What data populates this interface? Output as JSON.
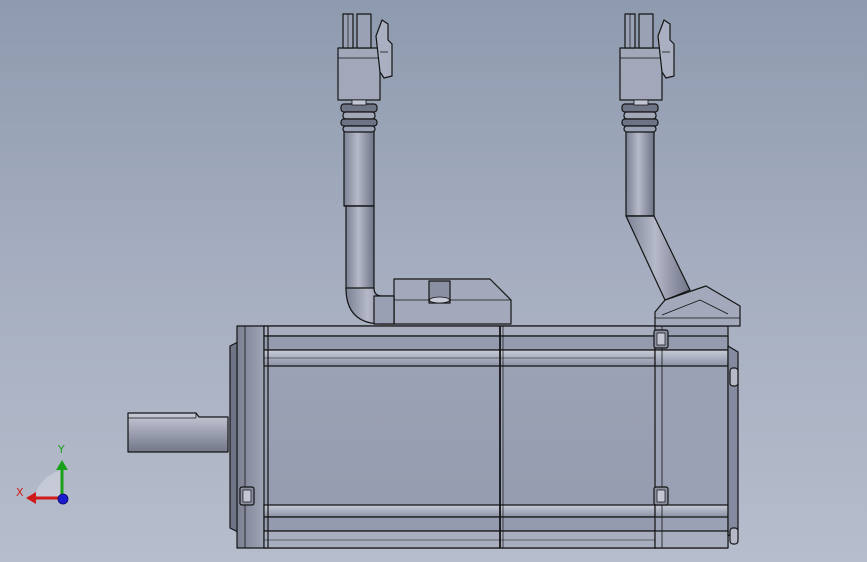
{
  "viewport": {
    "background_top": "#8e9aae",
    "background_bottom": "#b6bdcc"
  },
  "model": {
    "part_color": "#9ba1b4",
    "edge_color": "#141414",
    "components": [
      "motor-housing",
      "output-shaft",
      "front-flange",
      "power-connector",
      "encoder-connector",
      "power-cable",
      "encoder-cable",
      "connector-block",
      "rear-cable-gland"
    ]
  },
  "triad": {
    "x_label": "X",
    "y_label": "Y",
    "x_color": "#d01a1a",
    "y_color": "#1aa01a",
    "z_color": "#1a1ad0"
  }
}
